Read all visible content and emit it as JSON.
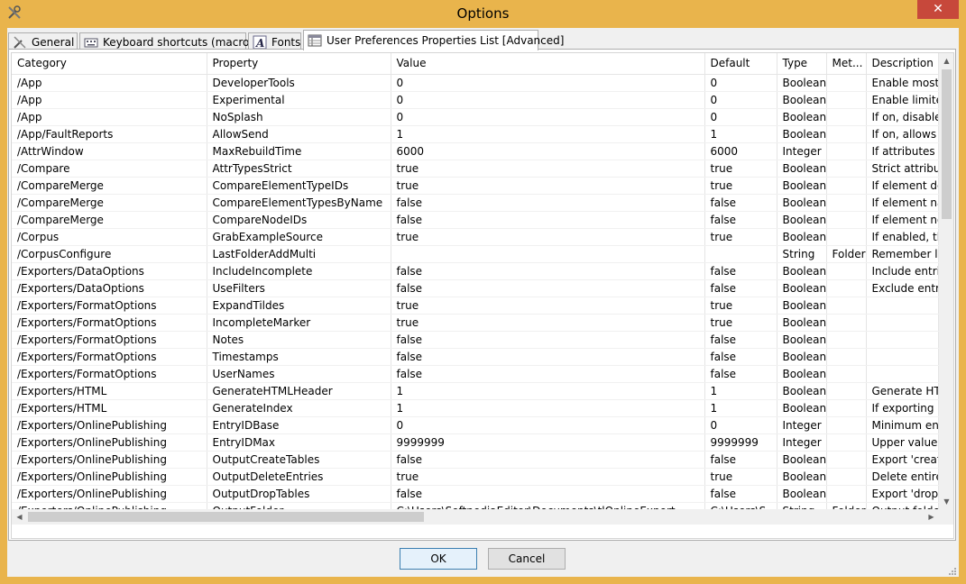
{
  "window": {
    "title": "Options",
    "close_label": "✕",
    "accent_color": "#e9b44c"
  },
  "tabs": [
    {
      "label": "General",
      "icon": "tools-icon"
    },
    {
      "label": "Keyboard shortcuts (macros)",
      "icon": "keyboard-icon"
    },
    {
      "label": "Fonts",
      "icon": "font-icon"
    },
    {
      "label": "User Preferences Properties List [Advanced]",
      "icon": "table-icon",
      "active": true
    }
  ],
  "table": {
    "columns": [
      "Category",
      "Property",
      "Value",
      "Default",
      "Type",
      "Met...",
      "Description"
    ],
    "rows": [
      [
        "/App",
        "DeveloperTools",
        "0",
        "0",
        "Boolean",
        "",
        "Enable mostly"
      ],
      [
        "/App",
        "Experimental",
        "0",
        "0",
        "Boolean",
        "",
        "Enable limited"
      ],
      [
        "/App",
        "NoSplash",
        "0",
        "0",
        "Boolean",
        "",
        "If on, disables"
      ],
      [
        "/App/FaultReports",
        "AllowSend",
        "1",
        "1",
        "Boolean",
        "",
        "If on, allows t"
      ],
      [
        "/AttrWindow",
        "MaxRebuildTime",
        "6000",
        "6000",
        "Integer",
        "",
        "If attributes w"
      ],
      [
        "/Compare",
        "AttrTypesStrict",
        "true",
        "true",
        "Boolean",
        "",
        "Strict attribut"
      ],
      [
        "/CompareMerge",
        "CompareElementTypeIDs",
        "true",
        "true",
        "Boolean",
        "",
        "If element de"
      ],
      [
        "/CompareMerge",
        "CompareElementTypesByName",
        "false",
        "false",
        "Boolean",
        "",
        "If element na"
      ],
      [
        "/CompareMerge",
        "CompareNodeIDs",
        "false",
        "false",
        "Boolean",
        "",
        "If element no"
      ],
      [
        "/Corpus",
        "GrabExampleSource",
        "true",
        "true",
        "Boolean",
        "",
        "If enabled, th"
      ],
      [
        "/CorpusConfigure",
        "LastFolderAddMulti",
        "",
        "",
        "String",
        "Folder",
        "Remember la"
      ],
      [
        "/Exporters/DataOptions",
        "IncludeIncomplete",
        "false",
        "false",
        "Boolean",
        "",
        "Include entrie"
      ],
      [
        "/Exporters/DataOptions",
        "UseFilters",
        "false",
        "false",
        "Boolean",
        "",
        "Exclude entrie"
      ],
      [
        "/Exporters/FormatOptions",
        "ExpandTildes",
        "true",
        "true",
        "Boolean",
        "",
        ""
      ],
      [
        "/Exporters/FormatOptions",
        "IncompleteMarker",
        "true",
        "true",
        "Boolean",
        "",
        ""
      ],
      [
        "/Exporters/FormatOptions",
        "Notes",
        "false",
        "false",
        "Boolean",
        "",
        ""
      ],
      [
        "/Exporters/FormatOptions",
        "Timestamps",
        "false",
        "false",
        "Boolean",
        "",
        ""
      ],
      [
        "/Exporters/FormatOptions",
        "UserNames",
        "false",
        "false",
        "Boolean",
        "",
        ""
      ],
      [
        "/Exporters/HTML",
        "GenerateHTMLHeader",
        "1",
        "1",
        "Boolean",
        "",
        "Generate HTM"
      ],
      [
        "/Exporters/HTML",
        "GenerateIndex",
        "1",
        "1",
        "Boolean",
        "",
        "If exporting e"
      ],
      [
        "/Exporters/OnlinePublishing",
        "EntryIDBase",
        "0",
        "0",
        "Integer",
        "",
        "Minimum ent"
      ],
      [
        "/Exporters/OnlinePublishing",
        "EntryIDMax",
        "9999999",
        "9999999",
        "Integer",
        "",
        "Upper value c"
      ],
      [
        "/Exporters/OnlinePublishing",
        "OutputCreateTables",
        "false",
        "false",
        "Boolean",
        "",
        "Export 'create"
      ],
      [
        "/Exporters/OnlinePublishing",
        "OutputDeleteEntries",
        "true",
        "true",
        "Boolean",
        "",
        "Delete entire"
      ],
      [
        "/Exporters/OnlinePublishing",
        "OutputDropTables",
        "false",
        "false",
        "Boolean",
        "",
        "Export 'drop t"
      ],
      [
        "/Exporters/OnlinePublishing",
        "OutputFolder",
        "C:\\Users\\SoftnediaEditor\\Documents\\tlOnlineExport",
        "C:\\Users\\S...",
        "String",
        "Folder",
        "Output folder"
      ]
    ]
  },
  "buttons": {
    "ok": "OK",
    "cancel": "Cancel"
  }
}
